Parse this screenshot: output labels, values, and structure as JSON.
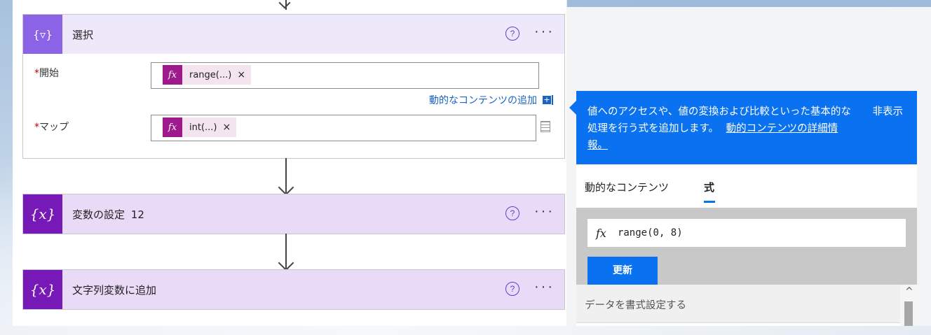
{
  "cards": {
    "select": {
      "title": "選択",
      "help": "?",
      "more": "···",
      "icon_glyph": "{▿}",
      "icon_color": "#8a63e6",
      "header_bg": "#eee8fb",
      "field_start": {
        "label": "開始",
        "required_mark": "*",
        "token": "range(...)",
        "token_remove": "×"
      },
      "add_dynamic": "動的なコンテンツの追加",
      "add_dynamic_icon": "+",
      "field_map": {
        "label": "マップ",
        "required_mark": "*",
        "token": "int(...)",
        "token_remove": "×"
      }
    },
    "set_var": {
      "title": "変数の設定",
      "suffix": "12",
      "help": "?",
      "more": "···",
      "icon_glyph": "{x}",
      "icon_color": "#7719b7"
    },
    "append_str": {
      "title": "文字列変数に追加",
      "help": "?",
      "more": "···",
      "icon_glyph": "{x}",
      "icon_color": "#7719b7"
    }
  },
  "popup": {
    "description": "値へのアクセスや、値の変換および比較といった基本的な処理を行う式を追加します。",
    "link": "動的コンテンツの詳細情報。",
    "hide": "非表示",
    "tabs": [
      {
        "label": "動的なコンテンツ",
        "active": false
      },
      {
        "label": "式",
        "active": true
      }
    ],
    "fx_symbol": "fx",
    "expression": "range(0, 8)",
    "update_button": "更新",
    "section": "データを書式設定する",
    "scroll_up": "^",
    "colors": {
      "accent": "#0a72f0",
      "gray_panel": "#c8c8c8"
    }
  }
}
